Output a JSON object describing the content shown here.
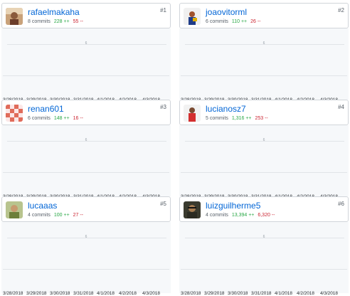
{
  "x_ticks": [
    "3/28/2018",
    "3/29/2018",
    "3/30/2018",
    "3/31/2018",
    "4/1/2018",
    "4/2/2018",
    "4/3/2018"
  ],
  "y_tick": "6",
  "contributors": [
    {
      "rank": "#1",
      "username": "rafaelmakaha",
      "commits": "8 commits",
      "additions": "228 ++",
      "deletions": "55 --"
    },
    {
      "rank": "#2",
      "username": "joaovitorml",
      "commits": "6 commits",
      "additions": "110 ++",
      "deletions": "26 --"
    },
    {
      "rank": "#3",
      "username": "renan601",
      "commits": "6 commits",
      "additions": "148 ++",
      "deletions": "16 --"
    },
    {
      "rank": "#4",
      "username": "lucianosz7",
      "commits": "5 commits",
      "additions": "1,316 ++",
      "deletions": "253 --"
    },
    {
      "rank": "#5",
      "username": "lucaaas",
      "commits": "4 commits",
      "additions": "100 ++",
      "deletions": "27 --"
    },
    {
      "rank": "#6",
      "username": "luizguilherme5",
      "commits": "4 commits",
      "additions": "13,394 ++",
      "deletions": "6,320 --"
    }
  ],
  "colors": {
    "link": "#0366d6",
    "additions": "#28a745",
    "deletions": "#cb2431",
    "chart_bg": "#f6f8fa"
  }
}
